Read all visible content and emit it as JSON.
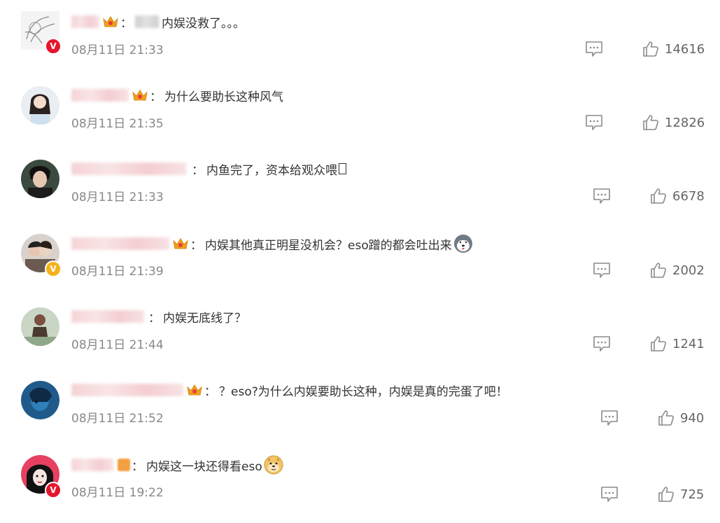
{
  "comments": [
    {
      "colon": "：",
      "text": "内娱没救了。。。",
      "time": "08月11日 21:33",
      "likes": "14616",
      "badge": {
        "type": "red",
        "glyph": "V"
      }
    },
    {
      "colon": "：",
      "text": "为什么要助长这种风气",
      "time": "08月11日 21:35",
      "likes": "12826",
      "badge": null
    },
    {
      "colon": "：",
      "text": "内鱼完了，资本给观众喂",
      "time": "08月11日 21:33",
      "likes": "6678",
      "badge": null
    },
    {
      "colon": "：",
      "text": "内娱其他真正明星没机会？eso蹭的都会吐出来",
      "time": "08月11日 21:39",
      "likes": "2002",
      "badge": {
        "type": "gold",
        "glyph": "V"
      }
    },
    {
      "colon": "：",
      "text": "内娱无底线了？",
      "time": "08月11日 21:44",
      "likes": "1241",
      "badge": null
    },
    {
      "colon": "：",
      "text": "？eso?为什么内娱要助长这种，内娱是真的完蛋了吧！",
      "time": "08月11日 21:52",
      "likes": "940",
      "badge": null
    },
    {
      "colon": "：",
      "text": "内娱这一块还得看eso",
      "time": "08月11日 19:22",
      "likes": "725",
      "badge": {
        "type": "red",
        "glyph": "V"
      }
    }
  ],
  "icons": {
    "reply": "comment-bubble-icon",
    "like": "thumbs-up-icon",
    "crown": "vip-crown-icon",
    "emoji_dog": "husky-emoji-icon",
    "emoji_doge": "doge-emoji-icon"
  },
  "colors": {
    "time": "#888888",
    "text": "#333333",
    "like": "#666666",
    "v_red": "#e6162d",
    "v_gold": "#f6b21c",
    "crown": "#f0a020"
  }
}
